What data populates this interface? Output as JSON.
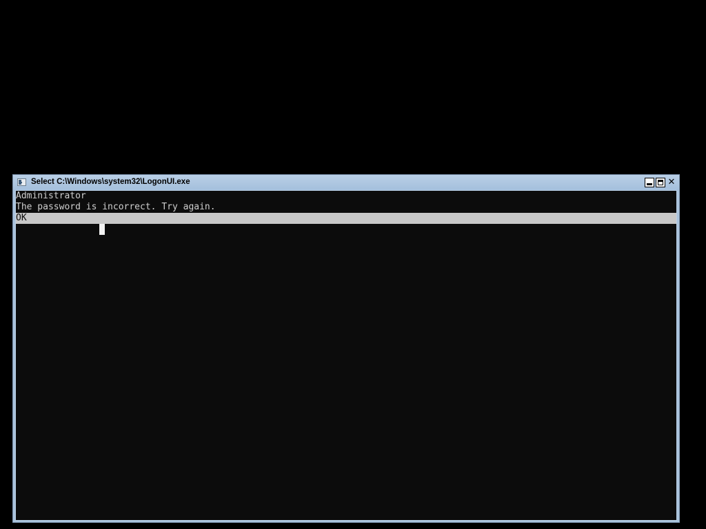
{
  "window": {
    "title": "Select C:\\Windows\\system32\\LogonUI.exe",
    "icon": "console-app-icon",
    "buttons": {
      "minimize_icon": "minimize-icon",
      "maximize_icon": "maximize-icon",
      "close_glyph": "✕"
    }
  },
  "console": {
    "username_line": "Administrator",
    "message_line": "The password is incorrect. Try again.",
    "ok_label": "OK"
  },
  "colors": {
    "background": "#000000",
    "console_background": "#0c0c0c",
    "console_text": "#cfcfcf",
    "selection_highlight": "#c8c8c8",
    "title_bar": "#a9c2dc"
  }
}
